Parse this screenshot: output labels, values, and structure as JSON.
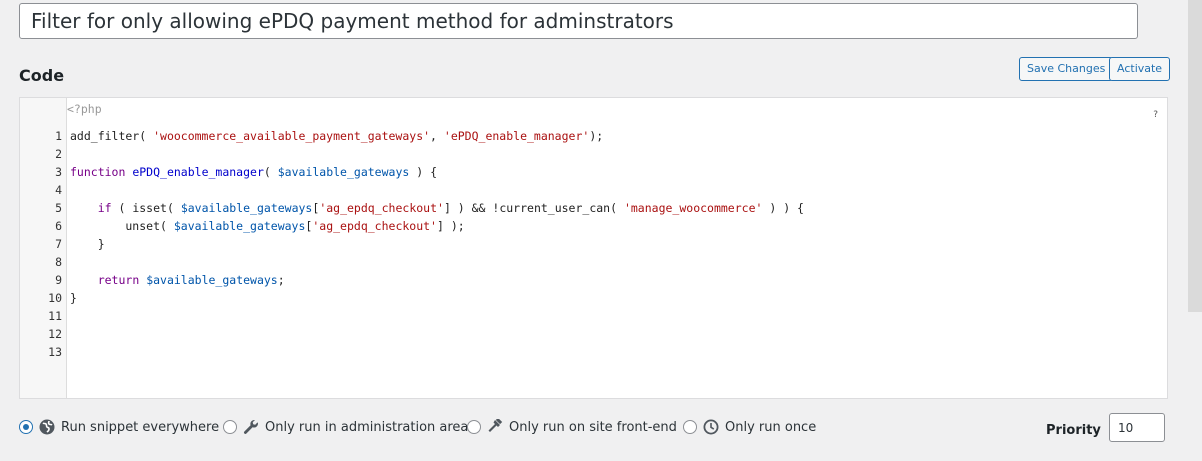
{
  "snippet": {
    "title": "Filter for only allowing ePDQ payment method for adminstrators"
  },
  "code_section": {
    "heading": "Code",
    "save_label": "Save Changes",
    "activate_label": "Activate",
    "php_open": "<?php",
    "help": "?",
    "lines": [
      {
        "num": "1",
        "text": "add_filter( 'woocommerce_available_payment_gateways', 'ePDQ_enable_manager');"
      },
      {
        "num": "2",
        "text": ""
      },
      {
        "num": "3",
        "text": "function ePDQ_enable_manager( $available_gateways ) {"
      },
      {
        "num": "4",
        "text": ""
      },
      {
        "num": "5",
        "text": "    if ( isset( $available_gateways['ag_epdq_checkout'] ) && !current_user_can( 'manage_woocommerce' ) ) {"
      },
      {
        "num": "6",
        "text": "        unset( $available_gateways['ag_epdq_checkout'] );"
      },
      {
        "num": "7",
        "text": "    }"
      },
      {
        "num": "8",
        "text": ""
      },
      {
        "num": "9",
        "text": "    return $available_gateways;"
      },
      {
        "num": "10",
        "text": "}"
      },
      {
        "num": "11",
        "text": ""
      },
      {
        "num": "12",
        "text": ""
      },
      {
        "num": "13",
        "text": ""
      }
    ]
  },
  "scope": {
    "selected": "everywhere",
    "options": [
      {
        "id": "everywhere",
        "label": "Run snippet everywhere",
        "icon": "globe-icon"
      },
      {
        "id": "admin",
        "label": "Only run in administration area",
        "icon": "wrench-icon"
      },
      {
        "id": "front-end",
        "label": "Only run on site front-end",
        "icon": "hammer-icon"
      },
      {
        "id": "once",
        "label": "Only run once",
        "icon": "clock-icon"
      }
    ]
  },
  "priority": {
    "label": "Priority",
    "value": "10"
  },
  "colors": {
    "accent": "#2271b1",
    "background": "#f0f0f1"
  }
}
